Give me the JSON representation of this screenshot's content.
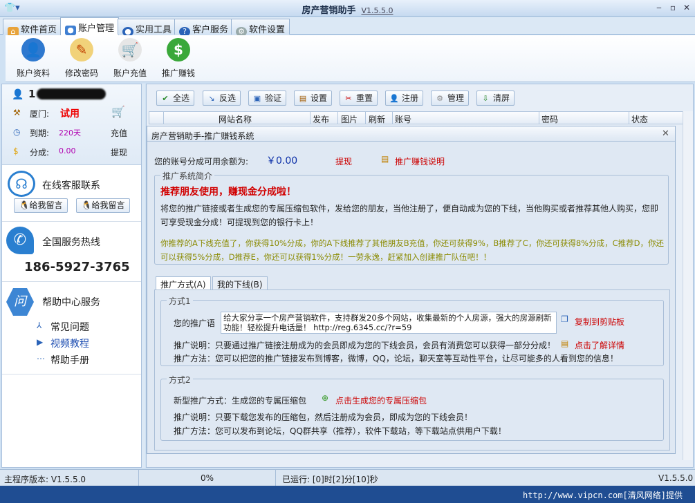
{
  "window": {
    "title": "房产营销助手",
    "version": "V1.5.5.0"
  },
  "tabs": [
    {
      "label": "软件首页"
    },
    {
      "label": "账户管理"
    },
    {
      "label": "实用工具"
    },
    {
      "label": "客户服务"
    },
    {
      "label": "软件设置"
    }
  ],
  "toolbar": [
    {
      "label": "账户资料",
      "icon": "user-search-icon"
    },
    {
      "label": "修改密码",
      "icon": "edit-icon"
    },
    {
      "label": "账户充值",
      "icon": "cart-icon"
    },
    {
      "label": "推广赚钱",
      "icon": "dollar-icon"
    }
  ],
  "account": {
    "name": "1",
    "city_label": "厦门:",
    "status": "试用",
    "expire_label": "到期:",
    "expire_value": "220天",
    "recharge": "充值",
    "share_label": "分成:",
    "share_value": "0.00",
    "withdraw": "提现"
  },
  "online": {
    "title": "在线客服联系",
    "btn1": "给我留言",
    "btn2": "给我留言"
  },
  "hotline": {
    "title": "全国服务热线",
    "number": "186-5927-3765"
  },
  "help": {
    "title": "帮助中心服务",
    "icon_text": "问",
    "items": [
      "常见问题",
      "视频教程",
      "帮助手册"
    ]
  },
  "actions": [
    {
      "label": "全选"
    },
    {
      "label": "反选"
    },
    {
      "label": "验证"
    },
    {
      "label": "设置"
    },
    {
      "label": "重置"
    },
    {
      "label": "注册"
    },
    {
      "label": "管理"
    },
    {
      "label": "清屏"
    }
  ],
  "grid_columns": [
    "网站名称",
    "发布",
    "图片",
    "刷新",
    "账号",
    "密码",
    "状态"
  ],
  "dialog": {
    "title": "房产营销助手-推广赚钱系统",
    "balance_label": "您的账号分成可用余额为:",
    "balance": "￥0.00",
    "withdraw": "提现",
    "explain_link": "推广赚钱说明",
    "intro_legend": "推广系统简介",
    "headline": "推荐朋友使用，赚现金分成啦！",
    "intro_text": "将您的推广链接或者生成您的专属压缩包软件，发给您的朋友，当他注册了，便自动成为您的下线，当他购买或者推荐其他人购买，您即可享受现金分成！可提现到您的银行卡上！",
    "rules_text": "你推荐的A下线充值了，你获得10%分成，你的A下线推荐了其他朋友B充值，你还可获得9%，B推荐了C，你还可获得8%分成，C推荐D，你还可以获得5%分成，D推荐E，你还可以获得1%分成！一劳永逸，赶紧加入创建推广队伍吧！！",
    "subtabs": [
      "推广方式(A)",
      "我的下线(B)"
    ],
    "way1": {
      "legend": "方式1",
      "link_label": "您的推广语",
      "link_text": "给大家分享一个房产营销软件，支持群发20多个网站，收集最新的个人房源，强大的房源刷新功能！轻松提升电话量！ http://reg.6345.cc/?r=59",
      "copy": "复制到剪贴板",
      "desc": "推广说明：只要通过推广链接注册成为的会员即成为您的下线会员，会员有消费您可以获得一部分分成！",
      "detail": "点击了解详情",
      "method": "推广方法：您可以把您的推广链接发布到博客，微博，QQ，论坛，聊天室等互动性平台，让尽可能多的人看到您的信息！"
    },
    "way2": {
      "legend": "方式2",
      "label": "新型推广方式：生成您的专属压缩包",
      "link": "点击生成您的专属压缩包",
      "desc": "推广说明：只要下载您发布的压缩包，然后注册成为会员，即成为您的下线会员！",
      "method": "推广方法：您可以发布到论坛，QQ群共享（推荐），软件下载站，等下载站点供用户下载！"
    }
  },
  "status": {
    "version": "主程序版本: V1.5.5.0",
    "progress": "0%",
    "runtime": "已运行: [0]时[2]分[10]秒",
    "right_ver": "V1.5.5.0"
  },
  "footer": "http://www.vipcn.com[清风网络]提供"
}
